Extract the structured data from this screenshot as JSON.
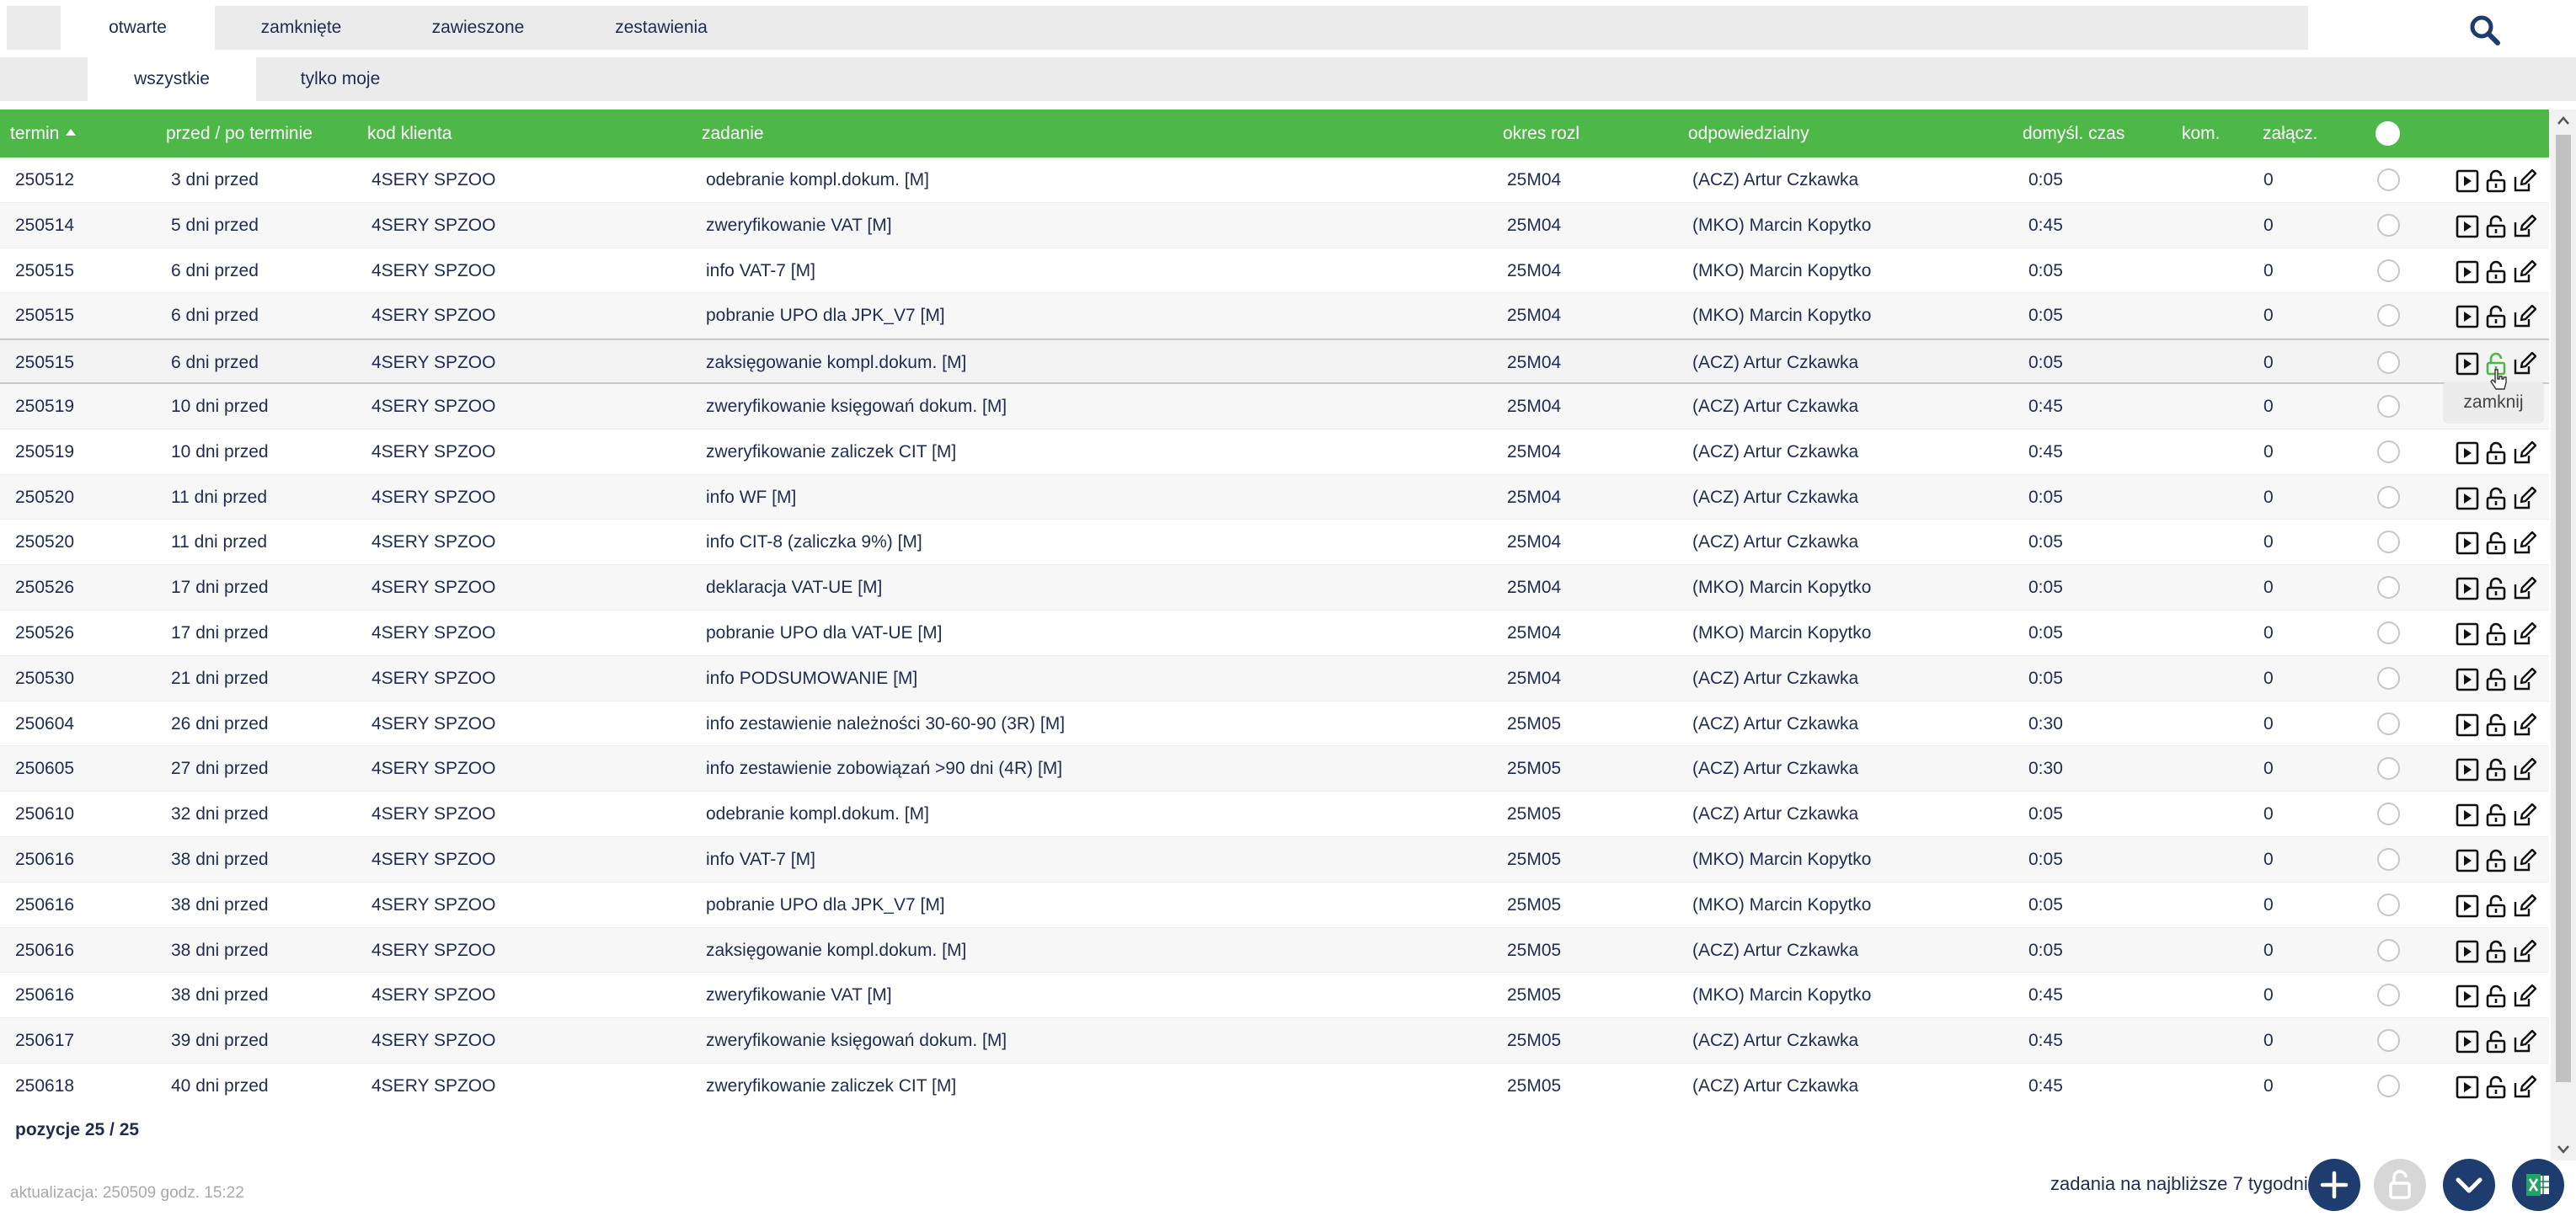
{
  "tabs": [
    {
      "label": "otwarte",
      "active": true
    },
    {
      "label": "zamknięte",
      "active": false
    },
    {
      "label": "zawieszone",
      "active": false
    },
    {
      "label": "zestawienia",
      "active": false
    }
  ],
  "subtabs": [
    {
      "label": "wszystkie",
      "active": true
    },
    {
      "label": "tylko moje",
      "active": false
    }
  ],
  "icons": {
    "search": "search-icon",
    "play": "play-icon",
    "lock": "lock-open-icon",
    "edit": "edit-icon",
    "add": "plus-icon",
    "down": "chevron-down-icon",
    "excel": "excel-icon"
  },
  "colors": {
    "header_green": "#4db847",
    "navy": "#1f3c6e",
    "text": "#1e2d4d",
    "hover_lock": "#4db847"
  },
  "table": {
    "headers": {
      "termin": "termin",
      "przed": "przed / po terminie",
      "kod": "kod klienta",
      "zadanie": "zadanie",
      "okres": "okres rozl",
      "odp": "odpowiedzialny",
      "czas": "domyśl. czas",
      "kom": "kom.",
      "zal": "załącz."
    },
    "rows": [
      {
        "termin": "250512",
        "przed": "3 dni przed",
        "kod": "4SERY SPZOO",
        "zadanie": "odebranie kompl.dokum. [M]",
        "okres": "25M04",
        "odp": "(ACZ) Artur Czkawka",
        "czas": "0:05",
        "zal": "0"
      },
      {
        "termin": "250514",
        "przed": "5 dni przed",
        "kod": "4SERY SPZOO",
        "zadanie": "zweryfikowanie VAT [M]",
        "okres": "25M04",
        "odp": "(MKO) Marcin Kopytko",
        "czas": "0:45",
        "zal": "0"
      },
      {
        "termin": "250515",
        "przed": "6 dni przed",
        "kod": "4SERY SPZOO",
        "zadanie": "info VAT-7 [M]",
        "okres": "25M04",
        "odp": "(MKO) Marcin Kopytko",
        "czas": "0:05",
        "zal": "0"
      },
      {
        "termin": "250515",
        "przed": "6 dni przed",
        "kod": "4SERY SPZOO",
        "zadanie": "pobranie UPO dla JPK_V7 [M]",
        "okres": "25M04",
        "odp": "(MKO) Marcin Kopytko",
        "czas": "0:05",
        "zal": "0"
      },
      {
        "termin": "250515",
        "przed": "6 dni przed",
        "kod": "4SERY SPZOO",
        "zadanie": "zaksięgowanie kompl.dokum. [M]",
        "okres": "25M04",
        "odp": "(ACZ) Artur Czkawka",
        "czas": "0:05",
        "zal": "0"
      },
      {
        "termin": "250519",
        "przed": "10 dni przed",
        "kod": "4SERY SPZOO",
        "zadanie": "zweryfikowanie księgowań dokum. [M]",
        "okres": "25M04",
        "odp": "(ACZ) Artur Czkawka",
        "czas": "0:45",
        "zal": "0"
      },
      {
        "termin": "250519",
        "przed": "10 dni przed",
        "kod": "4SERY SPZOO",
        "zadanie": "zweryfikowanie zaliczek CIT [M]",
        "okres": "25M04",
        "odp": "(ACZ) Artur Czkawka",
        "czas": "0:45",
        "zal": "0"
      },
      {
        "termin": "250520",
        "przed": "11 dni przed",
        "kod": "4SERY SPZOO",
        "zadanie": "info WF [M]",
        "okres": "25M04",
        "odp": "(ACZ) Artur Czkawka",
        "czas": "0:05",
        "zal": "0"
      },
      {
        "termin": "250520",
        "przed": "11 dni przed",
        "kod": "4SERY SPZOO",
        "zadanie": "info CIT-8 (zaliczka 9%) [M]",
        "okres": "25M04",
        "odp": "(ACZ) Artur Czkawka",
        "czas": "0:05",
        "zal": "0"
      },
      {
        "termin": "250526",
        "przed": "17 dni przed",
        "kod": "4SERY SPZOO",
        "zadanie": "deklaracja VAT-UE [M]",
        "okres": "25M04",
        "odp": "(MKO) Marcin Kopytko",
        "czas": "0:05",
        "zal": "0"
      },
      {
        "termin": "250526",
        "przed": "17 dni przed",
        "kod": "4SERY SPZOO",
        "zadanie": "pobranie UPO dla VAT-UE [M]",
        "okres": "25M04",
        "odp": "(MKO) Marcin Kopytko",
        "czas": "0:05",
        "zal": "0"
      },
      {
        "termin": "250530",
        "przed": "21 dni przed",
        "kod": "4SERY SPZOO",
        "zadanie": "info PODSUMOWANIE [M]",
        "okres": "25M04",
        "odp": "(ACZ) Artur Czkawka",
        "czas": "0:05",
        "zal": "0"
      },
      {
        "termin": "250604",
        "przed": "26 dni przed",
        "kod": "4SERY SPZOO",
        "zadanie": "info zestawienie należności 30-60-90 (3R) [M]",
        "okres": "25M05",
        "odp": "(ACZ) Artur Czkawka",
        "czas": "0:30",
        "zal": "0"
      },
      {
        "termin": "250605",
        "przed": "27 dni przed",
        "kod": "4SERY SPZOO",
        "zadanie": "info zestawienie zobowiązań >90 dni (4R) [M]",
        "okres": "25M05",
        "odp": "(ACZ) Artur Czkawka",
        "czas": "0:30",
        "zal": "0"
      },
      {
        "termin": "250610",
        "przed": "32 dni przed",
        "kod": "4SERY SPZOO",
        "zadanie": "odebranie kompl.dokum. [M]",
        "okres": "25M05",
        "odp": "(ACZ) Artur Czkawka",
        "czas": "0:05",
        "zal": "0"
      },
      {
        "termin": "250616",
        "przed": "38 dni przed",
        "kod": "4SERY SPZOO",
        "zadanie": "info VAT-7 [M]",
        "okres": "25M05",
        "odp": "(MKO) Marcin Kopytko",
        "czas": "0:05",
        "zal": "0"
      },
      {
        "termin": "250616",
        "przed": "38 dni przed",
        "kod": "4SERY SPZOO",
        "zadanie": "pobranie UPO dla JPK_V7 [M]",
        "okres": "25M05",
        "odp": "(MKO) Marcin Kopytko",
        "czas": "0:05",
        "zal": "0"
      },
      {
        "termin": "250616",
        "przed": "38 dni przed",
        "kod": "4SERY SPZOO",
        "zadanie": "zaksięgowanie kompl.dokum. [M]",
        "okres": "25M05",
        "odp": "(ACZ) Artur Czkawka",
        "czas": "0:05",
        "zal": "0"
      },
      {
        "termin": "250616",
        "przed": "38 dni przed",
        "kod": "4SERY SPZOO",
        "zadanie": "zweryfikowanie VAT [M]",
        "okres": "25M05",
        "odp": "(MKO) Marcin Kopytko",
        "czas": "0:45",
        "zal": "0"
      },
      {
        "termin": "250617",
        "przed": "39 dni przed",
        "kod": "4SERY SPZOO",
        "zadanie": "zweryfikowanie księgowań dokum. [M]",
        "okres": "25M05",
        "odp": "(ACZ) Artur Czkawka",
        "czas": "0:45",
        "zal": "0"
      },
      {
        "termin": "250618",
        "przed": "40 dni przed",
        "kod": "4SERY SPZOO",
        "zadanie": "zweryfikowanie zaliczek CIT [M]",
        "okres": "25M05",
        "odp": "(ACZ) Artur Czkawka",
        "czas": "0:45",
        "zal": "0"
      }
    ],
    "hover_row": 4
  },
  "tooltip": "zamknij",
  "footer": {
    "count": "pozycje 25 / 25",
    "updated": "aktualizacja: 250509 godz. 15:22",
    "upcoming": "zadania na najbliższe 7 tygodni"
  }
}
